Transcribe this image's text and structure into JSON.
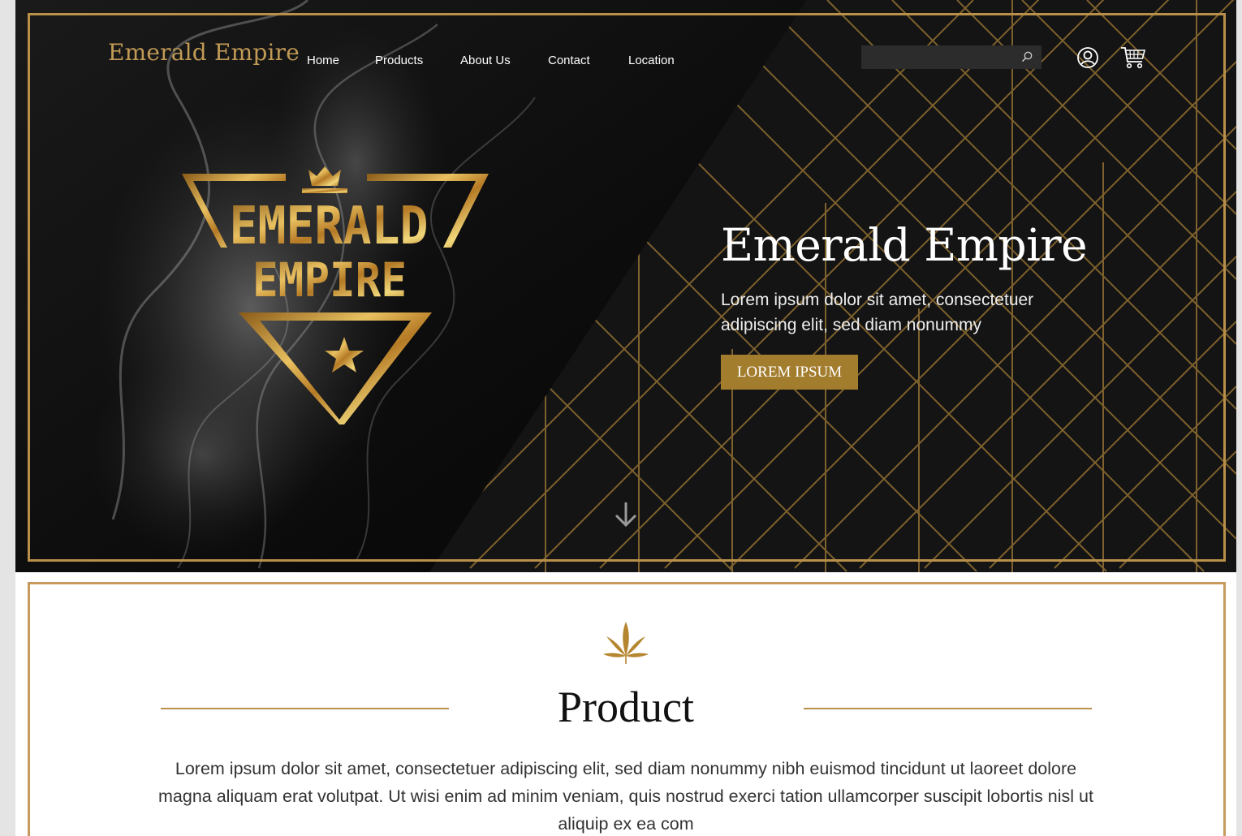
{
  "header": {
    "brand": "Emerald Empire",
    "nav": [
      "Home",
      "Products",
      "About Us",
      "Contact",
      "Location"
    ],
    "search": {
      "placeholder": "",
      "value": ""
    },
    "icons": {
      "search": "search-icon",
      "user": "user-icon",
      "cart": "cart-icon"
    }
  },
  "hero": {
    "logo_text": [
      "EMERALD",
      "EMPIRE"
    ],
    "title": "Emerald Empire",
    "subtitle": "Lorem ipsum dolor sit amet, consectetuer adipiscing elit, sed diam nonummy",
    "button_label": "LOREM IPSUM",
    "scroll_icon": "down-arrow-icon"
  },
  "product_section": {
    "icon": "cannabis-leaf-icon",
    "title": "Product",
    "text": "Lorem ipsum dolor sit amet, consectetuer adipiscing elit, sed diam nonummy nibh euismod tincidunt ut laoreet dolore magna aliquam erat volutpat. Ut wisi enim ad minim veniam, quis nostrud exerci tation ullamcorper suscipit lobortis nisl ut aliquip ex ea com"
  },
  "colors": {
    "gold": "#b98f4a",
    "button_gold": "#a37d2e",
    "hero_bg": "#121212",
    "page_bg": "#ffffff"
  }
}
